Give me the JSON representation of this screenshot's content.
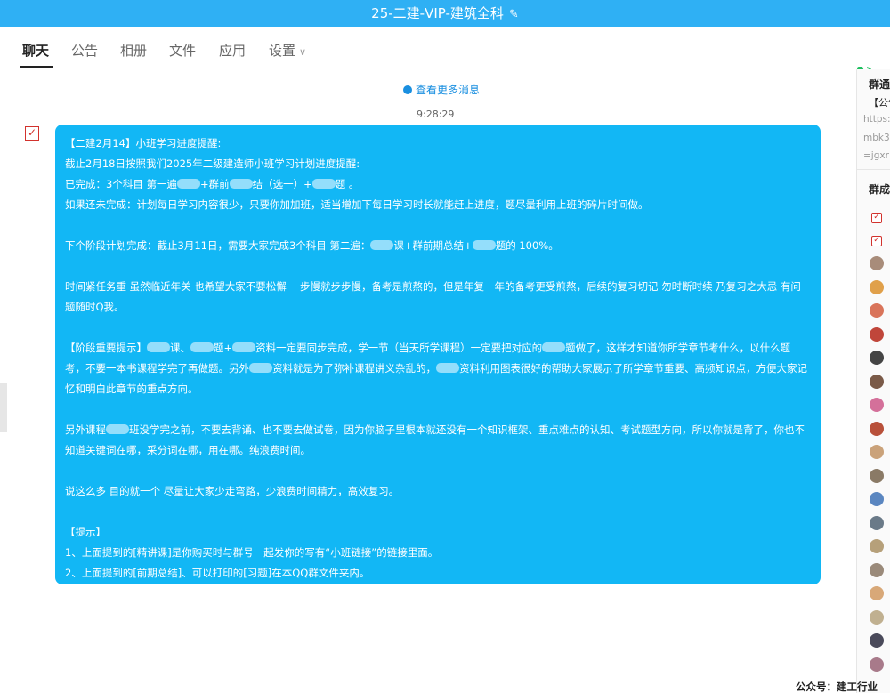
{
  "window": {
    "title": "25-二建-VIP-建筑全科",
    "edit_icon": "✎"
  },
  "tabs": [
    {
      "label": "聊天"
    },
    {
      "label": "公告"
    },
    {
      "label": "相册"
    },
    {
      "label": "文件"
    },
    {
      "label": "应用"
    },
    {
      "label": "设置"
    }
  ],
  "tabs_chevron": "∨",
  "chat": {
    "more_label": "查看更多消息",
    "time": "9:28:29",
    "check": "✓",
    "message_lines": [
      {
        "text": "【二建2月14】小班学习进度提醒:"
      },
      {
        "text": "截止2月18日按照我们2025年二级建造师小班学习计划进度提醒:"
      },
      {
        "a": "已完成：3个科目 第一遍",
        "b": "+群前",
        "c": "结（选一）+",
        "d": "题 。"
      },
      {
        "text": "如果还未完成：计划每日学习内容很少，只要你加加班，适当增加下每日学习时长就能赶上进度，题尽量利用上班的碎片时间做。"
      },
      {
        "text": ""
      },
      {
        "a": "下个阶段计划完成：截止3月11日，需要大家完成3个科目 第二遍：",
        "b": "课+群前期总结+",
        "c": "题的 100%。"
      },
      {
        "text": ""
      },
      {
        "text": "时间紧任务重 虽然临近年关 也希望大家不要松懈 一步慢就步步慢，备考是煎熬的，但是年复一年的备考更受煎熬，后续的复习切记 勿时断时续 乃复习之大忌 有问题随时Q我。",
        "wrap": true
      },
      {
        "text": ""
      },
      {
        "a": "【阶段重要提示】",
        "b": "课、",
        "c": "题+",
        "d": "资料一定要同步完成，学一节（当天所学课程）一定要把对应的",
        "e": "题做了，这样才知道你所学章节考什么，以什么题考，不要一本书课程学完了再做题。另外",
        "f": "资料就是为了弥补课程讲义杂乱的，",
        "g": "资料利用图表很好的帮助大家展示了所学章节重要、高频知识点，方便大家记忆和明白此章节的重点方向。"
      },
      {
        "text": ""
      },
      {
        "a": "另外课程",
        "b": "班没学完之前，不要去背诵、也不要去做试卷，因为你脑子里根本就还没有一个知识框架、重点难点的认知、考试题型方向，所以你就是背了，你也不知道关键词在哪，采分词在哪，用在哪。纯浪费时间。"
      },
      {
        "text": ""
      },
      {
        "text": "说这么多 目的就一个 尽量让大家少走弯路，少浪费时间精力，高效复习。"
      },
      {
        "text": ""
      },
      {
        "text": "【提示】"
      },
      {
        "text": "1、上面提到的[精讲课]是你购买时与群号一起发你的写有“小班链接”的链接里面。"
      },
      {
        "text": "2、上面提到的[前期总结]、可以打印的[习题]在本QQ群文件夹内。"
      }
    ]
  },
  "right_panel": {
    "notice_title": "群通",
    "notice_sub": "【公告",
    "link_lines": [
      "https:",
      "mbk3",
      "=jgxr"
    ],
    "members_title": "群成",
    "check": "✓"
  },
  "colors": {
    "title_bar": "#2fb0f4",
    "bubble": "#12b7f5",
    "accent_red": "#d2322d",
    "phone_green": "#20c060",
    "link_blue": "#1a8fe0"
  },
  "footer": "公众号：建工行业"
}
